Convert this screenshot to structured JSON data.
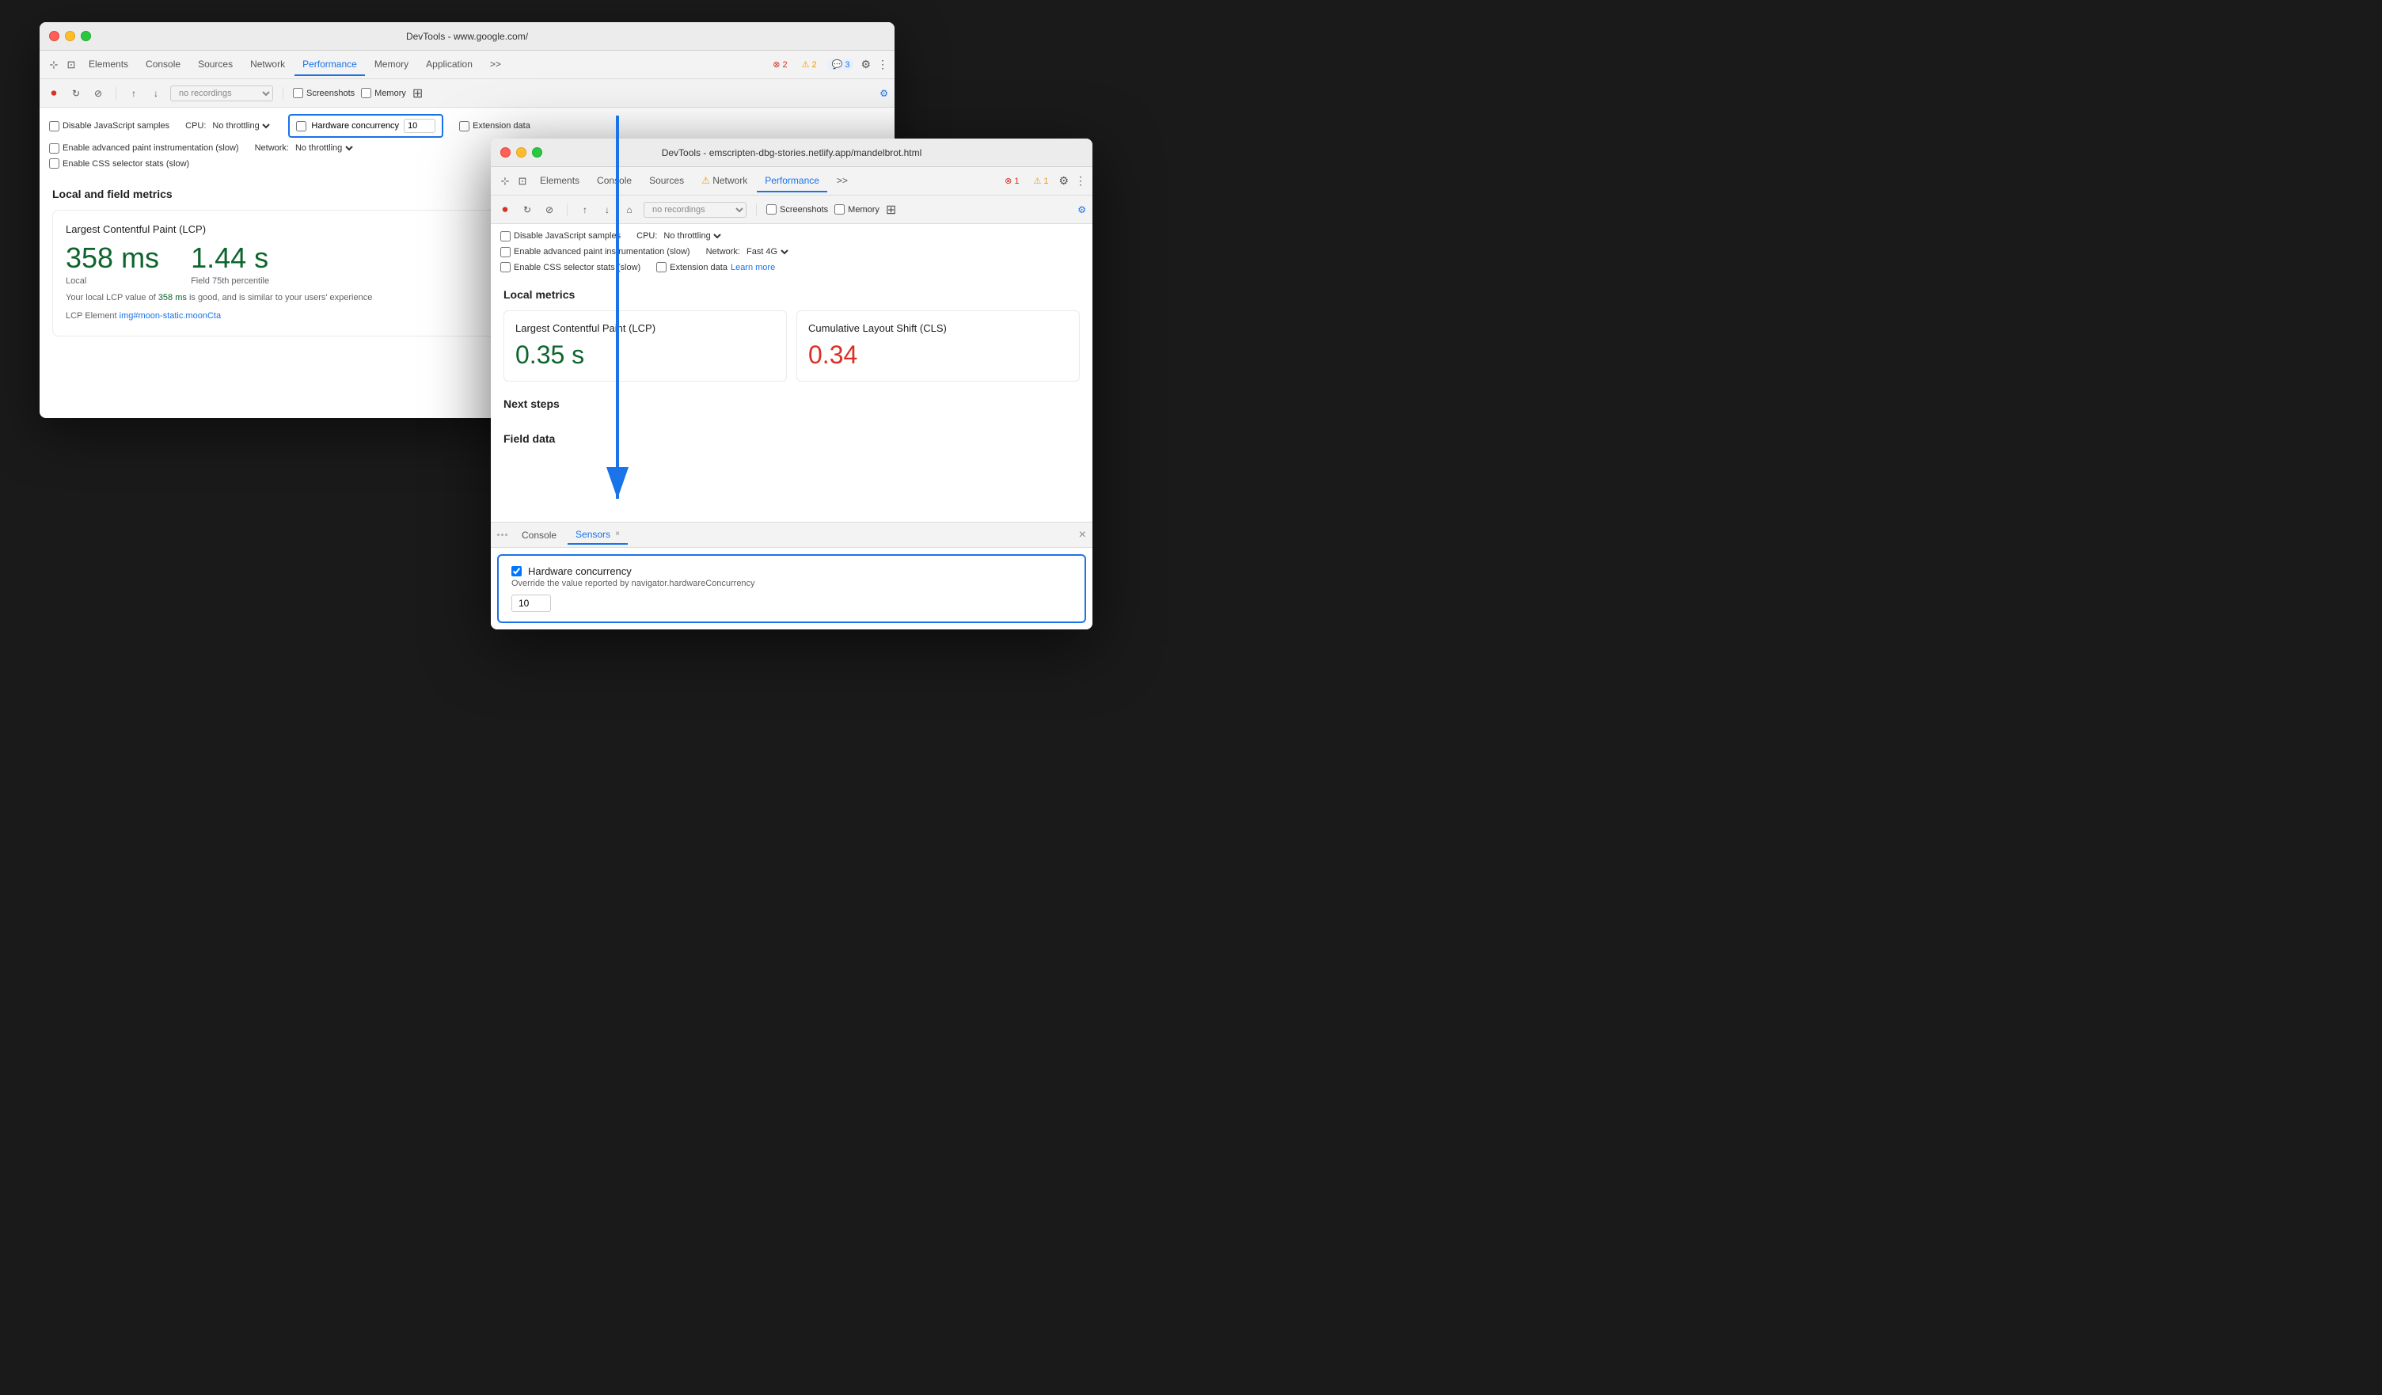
{
  "background": {
    "color": "#1a1a1a"
  },
  "back_window": {
    "title": "DevTools - www.google.com/",
    "tabs": [
      {
        "label": "Elements",
        "active": false
      },
      {
        "label": "Console",
        "active": false
      },
      {
        "label": "Sources",
        "active": false
      },
      {
        "label": "Network",
        "active": false
      },
      {
        "label": "Performance",
        "active": true
      },
      {
        "label": "Memory",
        "active": false
      },
      {
        "label": "Application",
        "active": false
      },
      {
        "label": ">>",
        "active": false
      }
    ],
    "badges": {
      "errors": "2",
      "warnings": "2",
      "info": "3"
    },
    "subtoolbar": {
      "recording_placeholder": "no recordings"
    },
    "checkboxes": {
      "screenshots": "Screenshots",
      "memory": "Memory"
    },
    "options": {
      "disable_js": "Disable JavaScript samples",
      "cpu_label": "CPU:",
      "cpu_value": "No throttling",
      "enable_paint": "Enable advanced paint instrumentation (slow)",
      "network_label": "Network:",
      "network_value": "No throttling",
      "enable_css": "Enable CSS selector stats (slow)",
      "hardware_concurrency": "Hardware concurrency",
      "hw_value": "10",
      "extension_data": "Extension data"
    },
    "main": {
      "section_title": "Local and field metrics",
      "lcp_title": "Largest Contentful Paint (LCP)",
      "lcp_local": "358 ms",
      "lcp_local_label": "Local",
      "lcp_field": "1.44 s",
      "lcp_field_label": "Field 75th percentile",
      "lcp_desc": "Your local LCP value of",
      "lcp_value_inline": "358 ms",
      "lcp_desc2": "is good, and is similar to your users' experience",
      "lcp_element_label": "LCP Element",
      "lcp_element_value": "img#moon-static.moonCta"
    }
  },
  "front_window": {
    "title": "DevTools - emscripten-dbg-stories.netlify.app/mandelbrot.html",
    "tabs": [
      {
        "label": "Elements",
        "active": false
      },
      {
        "label": "Console",
        "active": false
      },
      {
        "label": "Sources",
        "active": false
      },
      {
        "label": "Network",
        "active": false,
        "warning": true
      },
      {
        "label": "Performance",
        "active": true
      },
      {
        "label": ">>",
        "active": false
      }
    ],
    "badges": {
      "errors": "1",
      "warnings": "1"
    },
    "subtoolbar": {
      "recording_placeholder": "no recordings"
    },
    "checkboxes": {
      "screenshots": "Screenshots",
      "memory": "Memory"
    },
    "options": {
      "disable_js": "Disable JavaScript samples",
      "cpu_label": "CPU:",
      "cpu_value": "No throttling",
      "enable_paint": "Enable advanced paint instrumentation (slow)",
      "network_label": "Network:",
      "network_value": "Fast 4G",
      "enable_css": "Enable CSS selector stats (slow)",
      "extension_data": "Extension data",
      "learn_more": "Learn more"
    },
    "main": {
      "local_metrics_title": "Local metrics",
      "lcp_title": "Largest Contentful Paint (LCP)",
      "lcp_value": "0.35 s",
      "cls_title": "Cumulative Layout Shift (CLS)",
      "cls_value": "0.34",
      "next_steps_title": "Next steps",
      "field_data_title": "Field data"
    }
  },
  "drawer": {
    "tabs": [
      {
        "label": "Console",
        "active": false
      },
      {
        "label": "Sensors",
        "active": true,
        "closeable": true
      }
    ],
    "hardware_concurrency": {
      "title": "Hardware concurrency",
      "description": "Override the value reported by navigator.hardwareConcurrency",
      "value": "10",
      "checked": true
    }
  }
}
